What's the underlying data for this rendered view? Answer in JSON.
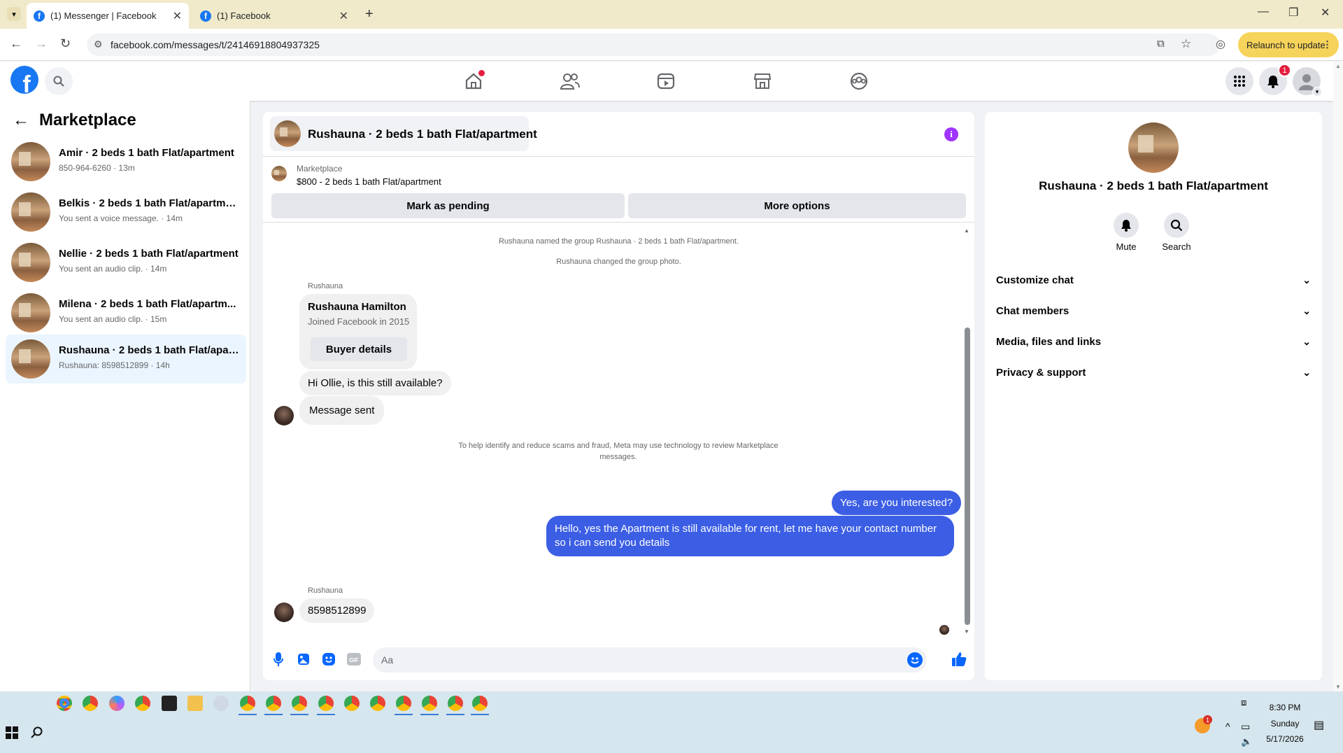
{
  "browser": {
    "tabs": [
      {
        "title": "(1) Messenger | Facebook",
        "active": true
      },
      {
        "title": "(1) Facebook",
        "active": false
      }
    ],
    "url": "facebook.com/messages/t/24146918804937325",
    "relaunch_label": "Relaunch to update",
    "new_tab_icon": "+",
    "close_glyph": "✕"
  },
  "header": {
    "logo_letter": "f",
    "notification_count": "1"
  },
  "sidebar": {
    "title": "Marketplace",
    "conversations": [
      {
        "name": "Amir · 2 beds 1 bath Flat/apartment",
        "preview": "850-964-6260 · 13m",
        "active": false
      },
      {
        "name": "Belkis · 2 beds 1 bath Flat/apartment",
        "preview": "You sent a voice message. · 14m",
        "active": false
      },
      {
        "name": "Nellie · 2 beds 1 bath Flat/apartment",
        "preview": "You sent an audio clip. · 14m",
        "active": false
      },
      {
        "name": "Milena · 2 beds 1 bath Flat/apartm...",
        "preview": "You sent an audio clip. · 15m",
        "active": false
      },
      {
        "name": "Rushauna · 2 beds 1 bath Flat/apar...",
        "preview": "Rushauna: 8598512899 · 14h",
        "active": true
      }
    ]
  },
  "chat": {
    "title": "Rushauna · 2 beds 1 bath Flat/apartment",
    "listing_source": "Marketplace",
    "listing_title": "$800 - 2 beds 1 bath Flat/apartment",
    "mark_pending_label": "Mark as pending",
    "more_options_label": "More options",
    "system_1": "Rushauna named the group Rushauna · 2 beds 1 bath Flat/apartment.",
    "system_2": "Rushauna changed the group photo.",
    "sender_name": "Rushauna",
    "profile_card_name": "Rushauna Hamilton",
    "profile_card_sub": "Joined Facebook in 2015",
    "buyer_details_label": "Buyer details",
    "msg_1": "Hi Ollie, is this still available?",
    "msg_2": "Message sent",
    "notice": "To help identify and reduce scams and fraud, Meta may use technology to review Marketplace messages.",
    "my_msg_1": "Yes, are you interested?",
    "my_msg_2": "Hello, yes the Apartment is still available for rent, let me have your contact number so i can send you details",
    "sender_name_2": "Rushauna",
    "msg_3": "8598512899",
    "composer_placeholder": "Aa"
  },
  "details": {
    "title": "Rushauna · 2 beds 1 bath Flat/apartment",
    "mute_label": "Mute",
    "search_label": "Search",
    "sections": [
      "Customize chat",
      "Chat members",
      "Media, files and links",
      "Privacy & support"
    ]
  },
  "taskbar": {
    "time": "8:30 PM",
    "day": "Sunday",
    "date": "5/17/2026",
    "badge": "1"
  },
  "colors": {
    "fb_blue": "#1877f2",
    "my_bubble": "#3b5ee4",
    "purple_info": "#a033ff"
  }
}
